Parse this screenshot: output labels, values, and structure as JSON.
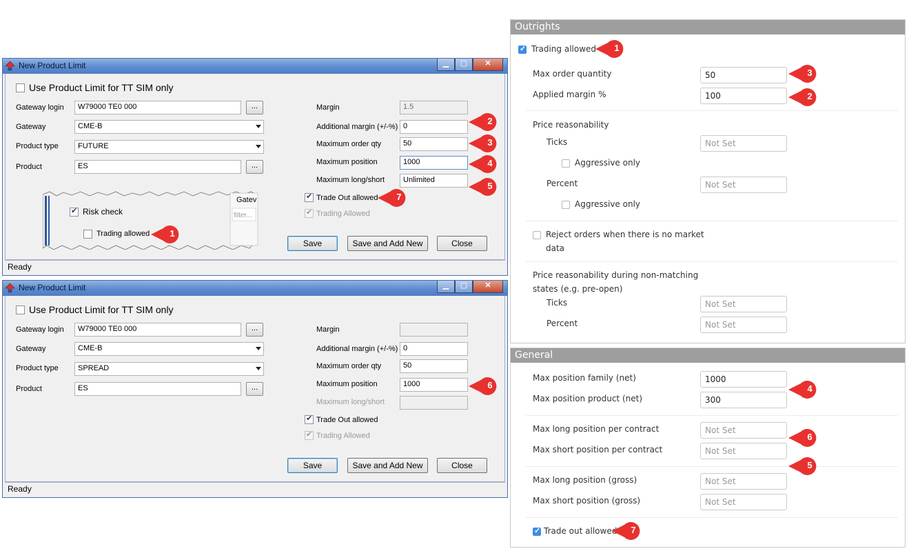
{
  "badge_color": "#e8312f",
  "dialog_top": {
    "title": "New Product Limit",
    "use_sim_only_label": "Use Product Limit for TT SIM only",
    "gateway_login_label": "Gateway login",
    "gateway_login_value": "W79000 TE0 000",
    "gateway_label": "Gateway",
    "gateway_value": "CME-B",
    "product_type_label": "Product type",
    "product_type_value": "FUTURE",
    "product_label": "Product",
    "product_value": "ES",
    "dots": "...",
    "margin_label": "Margin",
    "margin_value": "1.5",
    "additional_margin_label": "Additional margin (+/-%)",
    "additional_margin_value": "0",
    "max_order_qty_label": "Maximum order qty",
    "max_order_qty_value": "50",
    "max_position_label": "Maximum position",
    "max_position_value": "1000",
    "max_long_short_label": "Maximum long/short",
    "max_long_short_value": "Unlimited",
    "trade_out_label": "Trade Out allowed",
    "trading_allowed_label": "Trading Allowed",
    "risk_check_label": "Risk check",
    "trading_allowed_inset_label": "Trading allowed",
    "inset_col_header": "Gatev",
    "inset_filter": "filter...",
    "save": "Save",
    "save_add_new": "Save and Add New",
    "close": "Close",
    "status": "Ready",
    "badges": [
      "1",
      "2",
      "3",
      "4",
      "5",
      "7"
    ]
  },
  "dialog_bottom": {
    "title": "New Product Limit",
    "use_sim_only_label": "Use Product Limit for TT SIM only",
    "gateway_login_label": "Gateway login",
    "gateway_login_value": "W79000 TE0 000",
    "gateway_label": "Gateway",
    "gateway_value": "CME-B",
    "product_type_label": "Product type",
    "product_type_value": "SPREAD",
    "product_label": "Product",
    "product_value": "ES",
    "dots": "...",
    "margin_label": "Margin",
    "margin_value": "",
    "additional_margin_label": "Additional margin (+/-%)",
    "additional_margin_value": "0",
    "max_order_qty_label": "Maximum order qty",
    "max_order_qty_value": "50",
    "max_position_label": "Maximum position",
    "max_position_value": "1000",
    "max_long_short_label": "Maximum long/short",
    "trade_out_label": "Trade Out allowed",
    "trading_allowed_label": "Trading Allowed",
    "save": "Save",
    "save_add_new": "Save and Add New",
    "close": "Close",
    "status": "Ready",
    "badges": [
      "6"
    ]
  },
  "outrights": {
    "header": "Outrights",
    "trading_allowed_label": "Trading allowed",
    "max_order_qty_label": "Max order quantity",
    "max_order_qty_value": "50",
    "applied_margin_label": "Applied margin %",
    "applied_margin_value": "100",
    "price_reasonability_label": "Price reasonability",
    "ticks_label": "Ticks",
    "ticks_value": "Not Set",
    "aggressive_only_label": "Aggressive only",
    "percent_label": "Percent",
    "percent_value": "Not Set",
    "reject_orders_label_line1": "Reject orders when there is no market",
    "reject_orders_label_line2": "data",
    "non_matching_label_line1": "Price reasonability during non-matching",
    "non_matching_label_line2": "states (e.g. pre-open)",
    "nm_ticks_value": "Not Set",
    "nm_percent_value": "Not Set",
    "badges": [
      "1",
      "3",
      "2"
    ]
  },
  "general": {
    "header": "General",
    "max_pos_family_label": "Max position family (net)",
    "max_pos_family_value": "1000",
    "max_pos_product_label": "Max position product (net)",
    "max_pos_product_value": "300",
    "max_long_contract_label": "Max long position per contract",
    "max_long_contract_value": "Not Set",
    "max_short_contract_label": "Max short position per contract",
    "max_short_contract_value": "Not Set",
    "max_long_gross_label": "Max long position (gross)",
    "max_long_gross_value": "Not Set",
    "max_short_gross_label": "Max short position (gross)",
    "max_short_gross_value": "Not Set",
    "trade_out_label": "Trade out allowed",
    "badges": [
      "4",
      "6",
      "5",
      "7"
    ]
  }
}
